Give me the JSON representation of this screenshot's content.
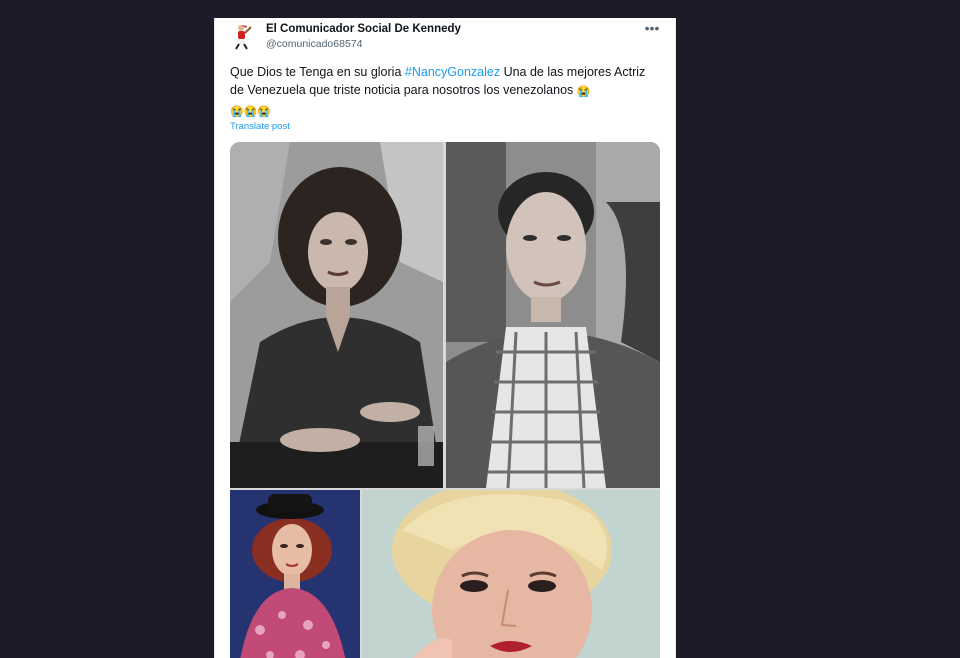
{
  "author": {
    "name": "El Comunicador Social De Kennedy",
    "handle": "@comunicado68574"
  },
  "tweet": {
    "text_before": "Que Dios te Tenga en su gloria ",
    "hashtag": "#NancyGonzalez",
    "text_after": " Una de las mejores Actriz de Venezuela que triste noticia para nosotros los venezolanos ",
    "emoji": "😭"
  },
  "translate_label": "Translate post",
  "more_label": "•••",
  "colors": {
    "background": "#1b1c28",
    "card": "#ffffff",
    "link": "#1d9bf0",
    "text": "#0f1419",
    "muted": "#536471"
  },
  "icons": {
    "avatar": "baseball-player-icon",
    "more": "more-options-icon"
  }
}
